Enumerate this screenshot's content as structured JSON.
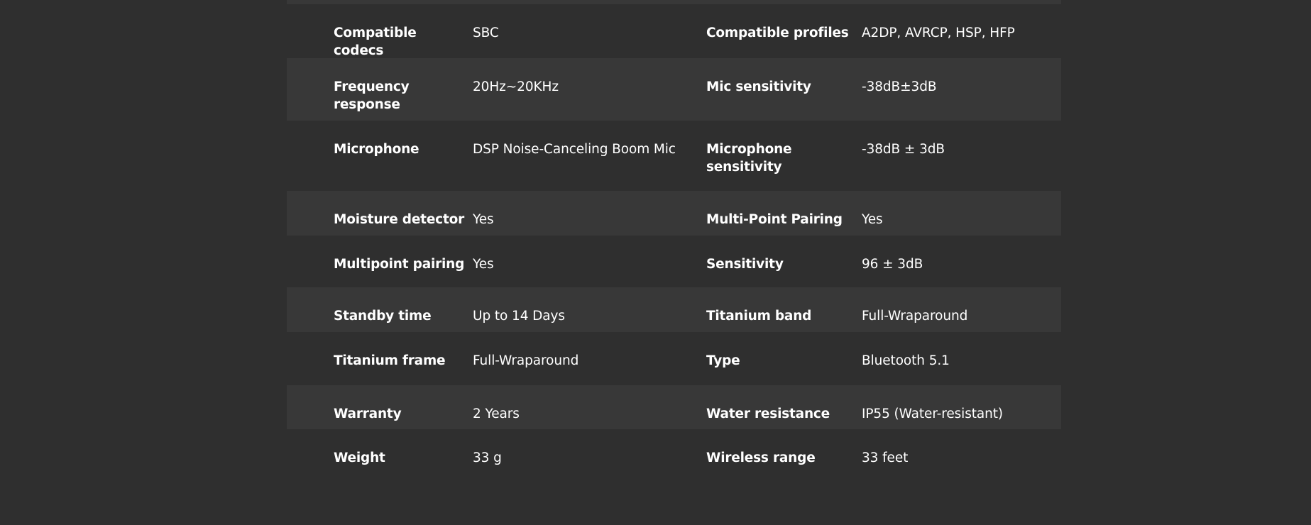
{
  "specs": {
    "rows": [
      {
        "label1": "Compatible codecs",
        "value1": "SBC",
        "label2": "Compatible profiles",
        "value2": "A2DP, AVRCP, HSP, HFP"
      },
      {
        "label1": "Frequency response",
        "value1": "20Hz~20KHz",
        "label2": "Mic sensitivity",
        "value2": "-38dB±3dB"
      },
      {
        "label1": "Microphone",
        "value1": "DSP Noise-Canceling Boom Mic",
        "label2": "Microphone sensitivity",
        "value2": "-38dB ± 3dB"
      },
      {
        "label1": "Moisture detector",
        "value1": "Yes",
        "label2": "Multi-Point Pairing",
        "value2": "Yes"
      },
      {
        "label1": "Multipoint pairing",
        "value1": "Yes",
        "label2": "Sensitivity",
        "value2": "96 ± 3dB"
      },
      {
        "label1": "Standby time",
        "value1": "Up to 14 Days",
        "label2": "Titanium band",
        "value2": "Full-Wraparound"
      },
      {
        "label1": "Titanium frame",
        "value1": "Full-Wraparound",
        "label2": "Type",
        "value2": "Bluetooth 5.1"
      },
      {
        "label1": "Warranty",
        "value1": "2 Years",
        "label2": "Water resistance",
        "value2": "IP55 (Water-resistant)"
      },
      {
        "label1": "Weight",
        "value1": "33 g",
        "label2": "Wireless range",
        "value2": "33 feet"
      }
    ]
  }
}
